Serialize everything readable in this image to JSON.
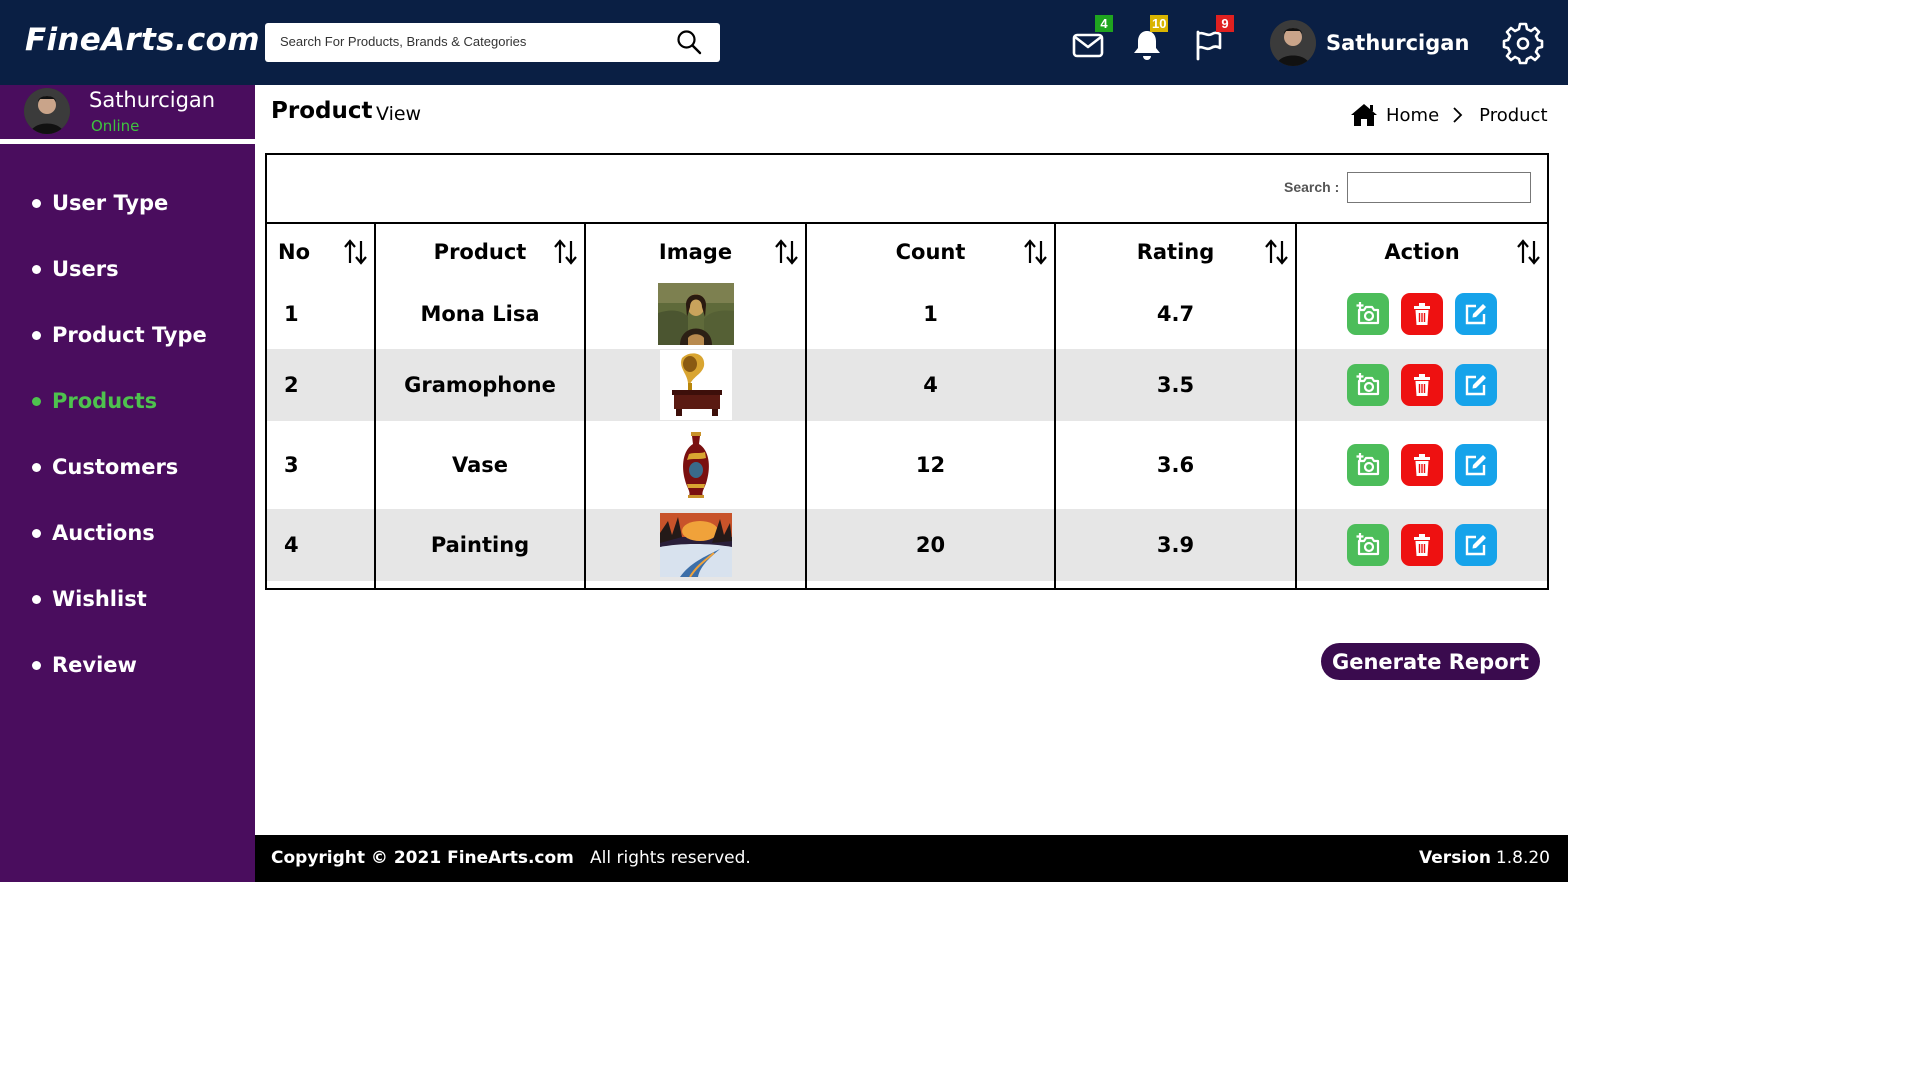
{
  "header": {
    "logo": "FineArts.com",
    "search_placeholder": "Search For Products, Brands & Categories",
    "mail_count": "4",
    "bell_count": "10",
    "flag_count": "9",
    "user_name": "Sathurcigan"
  },
  "sidebar": {
    "user_name": "Sathurcigan",
    "status": "Online",
    "items": [
      {
        "label": "User Type"
      },
      {
        "label": "Users"
      },
      {
        "label": "Product Type"
      },
      {
        "label": "Products"
      },
      {
        "label": "Customers"
      },
      {
        "label": "Auctions"
      },
      {
        "label": "Wishlist"
      },
      {
        "label": "Review"
      }
    ],
    "active_item": "Products"
  },
  "page": {
    "title": "Product",
    "subtitle": "View",
    "breadcrumb": {
      "home": "Home",
      "current": "Product"
    }
  },
  "table": {
    "search_label": "Search :",
    "columns": [
      "No",
      "Product",
      "Image",
      "Count",
      "Rating",
      "Action"
    ],
    "rows": [
      {
        "no": "1",
        "product": "Mona Lisa",
        "count": "1",
        "rating": "4.7"
      },
      {
        "no": "2",
        "product": "Gramophone",
        "count": "4",
        "rating": "3.5"
      },
      {
        "no": "3",
        "product": "Vase",
        "count": "12",
        "rating": "3.6"
      },
      {
        "no": "4",
        "product": "Painting",
        "count": "20",
        "rating": "3.9"
      }
    ]
  },
  "actions": {
    "generate_report": "Generate Report"
  },
  "footer": {
    "copyright": "Copyright  ©  2021  FineArts.com",
    "rights": "All rights reserved.",
    "version_label": "Version",
    "version": "1.8.20"
  },
  "colors": {
    "topbar": "#0a1f44",
    "sidebar": "#4a0d5e",
    "active_menu": "#4ec24e",
    "badge_mail": "#1fa51f",
    "badge_bell": "#d9b400",
    "badge_flag": "#e02020",
    "action_add_photo": "#4cbd5a",
    "action_delete": "#ee1111",
    "action_edit": "#16a3ea",
    "report_button": "#3a0b4e"
  },
  "icons": [
    "search-icon",
    "mail-icon",
    "bell-icon",
    "flag-icon",
    "gear-icon",
    "home-icon",
    "chevron-right-icon",
    "sort-icon",
    "add-photo-icon",
    "trash-icon",
    "edit-icon"
  ]
}
